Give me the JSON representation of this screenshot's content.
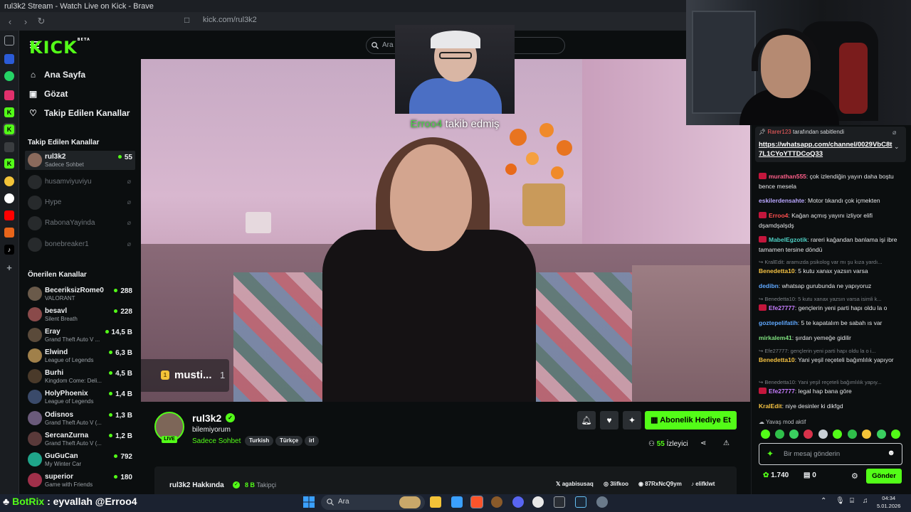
{
  "window": {
    "title": "rul3k2 Stream - Watch Live on Kick - Brave"
  },
  "browser": {
    "url_host": "kick.com/",
    "url_path": "rul3k2"
  },
  "header": {
    "logo": "KICK",
    "logo_badge": "BETA",
    "search_placeholder": "Ara"
  },
  "sidebar": {
    "nav": [
      {
        "label": "Ana Sayfa",
        "icon": "home-icon"
      },
      {
        "label": "Gözat",
        "icon": "browse-icon"
      },
      {
        "label": "Takip Edilen Kanallar",
        "icon": "heart-icon"
      }
    ],
    "followed_title": "Takip Edilen Kanallar",
    "followed": [
      {
        "name": "rul3k2",
        "sub": "Sadece Sohbet",
        "viewers": "55",
        "live": true
      },
      {
        "name": "husamviyuviyu",
        "live": false
      },
      {
        "name": "Hype",
        "live": false
      },
      {
        "name": "RabonaYayinda",
        "live": false
      },
      {
        "name": "bonebreaker1",
        "live": false
      }
    ],
    "recommended_title": "Önerilen Kanallar",
    "recommended": [
      {
        "name": "BeceriksizRome0",
        "sub": "VALORANT",
        "viewers": "288"
      },
      {
        "name": "besavl",
        "sub": "Silent Breath",
        "viewers": "228"
      },
      {
        "name": "Eray",
        "sub": "Grand Theft Auto V ...",
        "viewers": "14,5 B"
      },
      {
        "name": "Elwind",
        "sub": "League of Legends",
        "viewers": "6,3 B"
      },
      {
        "name": "Burhi",
        "sub": "Kingdom Come: Deli...",
        "viewers": "4,5 B"
      },
      {
        "name": "HolyPhoenix",
        "sub": "League of Legends",
        "viewers": "1,4 B"
      },
      {
        "name": "Odisnos",
        "sub": "Grand Theft Auto V (...",
        "viewers": "1,3 B"
      },
      {
        "name": "SercanZurna",
        "sub": "Grand Theft Auto V (...",
        "viewers": "1,2 B"
      },
      {
        "name": "GuGuCan",
        "sub": "My Winter Car",
        "viewers": "792"
      },
      {
        "name": "superior",
        "sub": "Game with Friends",
        "viewers": "180"
      }
    ]
  },
  "video": {
    "follow_user": "Erroo4",
    "follow_text": "takib edmiş",
    "gift_user": "musti...",
    "gift_count": "1"
  },
  "stream": {
    "name": "rul3k2",
    "live_label": "LIVE",
    "title": "bilemiyorum",
    "category": "Sadece Sohbet",
    "tags": [
      "Turkish",
      "Türkçe",
      "irl"
    ],
    "sub_gift_button": "Abonelik Hediye Et",
    "viewers_count": "55",
    "viewers_label": "İzleyici",
    "about_title": "rul3k2 Hakkında",
    "followers_count": "8 B",
    "followers_label": "Takipçi",
    "socials": [
      "agabisusaq",
      "3lifkoo",
      "87RxNcQ9ym",
      "elifklwt"
    ]
  },
  "chat": {
    "pinned_by_user": "Rarer123",
    "pinned_by_text": "tarafından sabitlendi",
    "pinned_link": "https://whatsapp.com/channel/0029VbC8t7L1CYoYTTDCoQ33",
    "messages": [
      {
        "user": "murathan555",
        "color": "#ff5f8a",
        "badge": true,
        "text": "çok izlendiğin yayın daha boştu bence mesela"
      },
      {
        "user": "eskilerdensahte",
        "color": "#b9a7ff",
        "badge": false,
        "text": "Motor tıkandı çok içmekten"
      },
      {
        "user": "Erroo4",
        "color": "#ff4f4f",
        "badge": true,
        "text": "Kağan açmış yayını izliyor elifi dşamdşalşdş"
      },
      {
        "user": "MabelEgzotik",
        "color": "#4fd1c5",
        "badge": true,
        "text": "rareri kağandan banlama işi ibre tamamen tersine döndü"
      },
      {
        "reply": "KralEdit: aramızda psikolog var mı şu kıza yardı..."
      },
      {
        "user": "Benedetta10",
        "color": "#f6c343",
        "badge": false,
        "text": "5 kutu xanax yazsın varsa"
      },
      {
        "user": "dedibn",
        "color": "#5fa8ff",
        "badge": false,
        "text": "whatsap gurubunda ne yapıyoruz"
      },
      {
        "reply": "Benedetta10: 5 kutu xanax yazsın varsa isimli k..."
      },
      {
        "user": "Efe27777",
        "color": "#c77dff",
        "badge": true,
        "text": "gençlerin yeni parti hapı oldu la o"
      },
      {
        "user": "goztepelifatih",
        "color": "#5fa8ff",
        "badge": false,
        "text": "5 te kapatalım be sabah ıs var"
      },
      {
        "user": "mirkalem41",
        "color": "#7ee07e",
        "badge": false,
        "text": "şırdan yemeğe gidilir"
      },
      {
        "reply": "Efe27777: gençlerin yeni parti hapı oldu la o i..."
      },
      {
        "user": "Benedetta10",
        "color": "#f6c343",
        "badge": false,
        "text": "Yani yeşil reçeteli bağımlılık yapıyor"
      },
      {
        "reply": "Benedetta10: Yani yeşil reçeteli bağımlılık yapıy..."
      },
      {
        "user": "Efe27777",
        "color": "#c77dff",
        "badge": true,
        "text": "legal hap bana göre"
      },
      {
        "user": "KralEdit",
        "color": "#f6c343",
        "badge": false,
        "text": "niye desinler ki dikfgd"
      }
    ],
    "slow_mode": "Yavaş mod aktif",
    "input_placeholder": "Bir mesaj gönderin",
    "points": "1.740",
    "gifts": "0",
    "send_label": "Gönder"
  },
  "taskbar": {
    "overlay_user": "BotRix",
    "overlay_text": ": eyvallah @Erroo4",
    "search_placeholder": "Ara",
    "time": "04:34",
    "date": "5.01.2026"
  }
}
